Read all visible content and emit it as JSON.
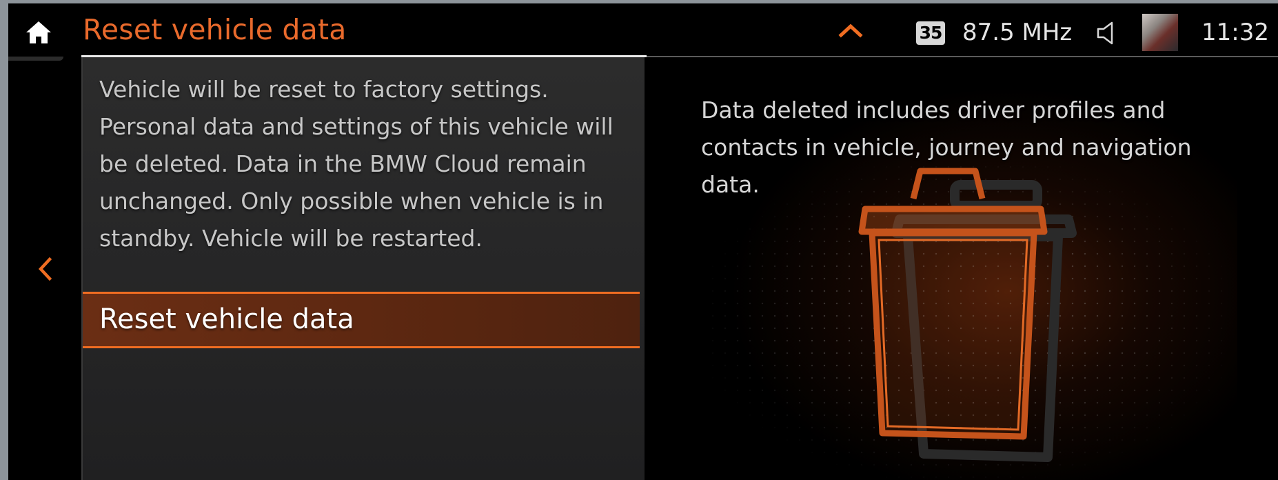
{
  "header": {
    "title": "Reset vehicle data",
    "radio_preset": "35",
    "radio_frequency": "87.5 MHz",
    "clock": "11:32"
  },
  "icons": {
    "home": "home-icon",
    "expand": "chevron-up-icon",
    "speaker": "speaker-icon",
    "back": "chevron-left-icon",
    "illustration": "trash-can-icon"
  },
  "colors": {
    "accent": "#e96a2c",
    "selection_border": "#f06d22",
    "selection_fill": "#6b2e14",
    "text_primary": "#ffffff",
    "text_secondary": "#c7c7c7"
  },
  "main": {
    "description": "Vehicle will be reset to factory settings. Personal data and settings of this vehicle will be deleted. Data in the BMW Cloud remain unchanged. Only possible when vehicle is in standby. Vehicle will be restarted.",
    "action_label": "Reset vehicle data"
  },
  "info": {
    "text": "Data deleted includes driver profiles and contacts in vehicle, journey and navigation data."
  }
}
